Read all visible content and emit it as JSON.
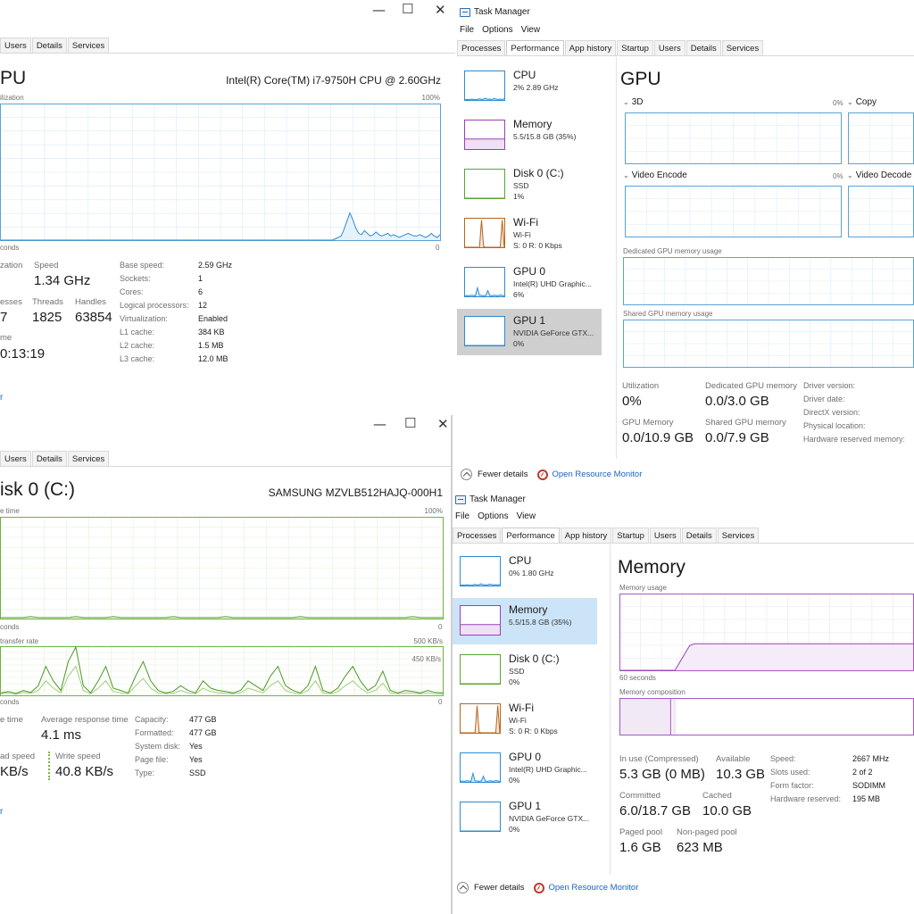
{
  "common": {
    "tabs_short": [
      "Users",
      "Details",
      "Services"
    ],
    "tabs_full": [
      "Processes",
      "Performance",
      "App history",
      "Startup",
      "Users",
      "Details",
      "Services"
    ],
    "menu": [
      "File",
      "Options",
      "View"
    ],
    "app_title": "Task Manager",
    "fewer_details": "Fewer details",
    "open_resource_monitor": "Open Resource Monitor",
    "win_min": "—",
    "win_max": "☐",
    "win_close": "✕"
  },
  "cpu_panel": {
    "title": "PU",
    "cpu_name": "Intel(R) Core(TM) i7-9750H CPU @ 2.60GHz",
    "graph_label": "ilization",
    "graph_max": "100%",
    "time_left": "conds",
    "time_right": "0",
    "utilization_label": "zation",
    "utilization_value": "",
    "speed_label": "Speed",
    "speed_value": "1.34 GHz",
    "processes_label": "esses",
    "processes_value": "7",
    "threads_label": "Threads",
    "threads_value": "1825",
    "handles_label": "Handles",
    "handles_value": "63854",
    "uptime_label": "me",
    "uptime_value": "0:13:19",
    "link_frag": "r",
    "specs": [
      {
        "k": "Base speed:",
        "v": "2.59 GHz"
      },
      {
        "k": "Sockets:",
        "v": "1"
      },
      {
        "k": "Cores:",
        "v": "6"
      },
      {
        "k": "Logical processors:",
        "v": "12"
      },
      {
        "k": "Virtualization:",
        "v": "Enabled"
      },
      {
        "k": "L1 cache:",
        "v": "384 KB"
      },
      {
        "k": "L2 cache:",
        "v": "1.5 MB"
      },
      {
        "k": "L3 cache:",
        "v": "12.0 MB"
      }
    ],
    "series": [
      0,
      0,
      0,
      0,
      0,
      0,
      0,
      0,
      0,
      0,
      0,
      0,
      0,
      0,
      0,
      0,
      0,
      0,
      0,
      0,
      0,
      0,
      0,
      0,
      0,
      0,
      0,
      0,
      0,
      0,
      0,
      0,
      0,
      0,
      0,
      0,
      0,
      0,
      0,
      0,
      0,
      0,
      0,
      0,
      0,
      0,
      0,
      0,
      0,
      0,
      0,
      0,
      0,
      0,
      0,
      0,
      0,
      0,
      0,
      0,
      0,
      0,
      0,
      0,
      0,
      0,
      0,
      0,
      0,
      0,
      0,
      0,
      0,
      0,
      0,
      0,
      0,
      0,
      0,
      0,
      0,
      0,
      0,
      0,
      0,
      0,
      0,
      0,
      0,
      0,
      0,
      0,
      0,
      0,
      0,
      0,
      0,
      0,
      0,
      0,
      0,
      0,
      0,
      0,
      0,
      0,
      0,
      0,
      0,
      0,
      0,
      0,
      0,
      0,
      0,
      1,
      2,
      3,
      8,
      14,
      20,
      15,
      9,
      5,
      4,
      7,
      5,
      3,
      4,
      6,
      4,
      3,
      4,
      5,
      3,
      4,
      3,
      2,
      3,
      4,
      5,
      4,
      3,
      3,
      4,
      3,
      2,
      3,
      5,
      3,
      2,
      4
    ]
  },
  "gpu_panel": {
    "sidebar": [
      {
        "title": "CPU",
        "s1": "2% 2.89 GHz",
        "s2": "",
        "color": "#2c8cd1",
        "fill": "#cfe7f7",
        "kind": "cpu"
      },
      {
        "title": "Memory",
        "s1": "5.5/15.8 GB (35%)",
        "s2": "",
        "color": "#9b3fb5",
        "fill": "#efe0f5",
        "kind": "mem"
      },
      {
        "title": "Disk 0 (C:)",
        "s1": "SSD",
        "s2": "1%",
        "color": "#5aa431",
        "fill": "#e8f4df",
        "kind": "flat"
      },
      {
        "title": "Wi-Fi",
        "s1": "Wi-Fi",
        "s2": "S: 0 R: 0 Kbps",
        "color": "#b5651d",
        "fill": "#f6e6d6",
        "kind": "wifi"
      },
      {
        "title": "GPU 0",
        "s1": "Intel(R) UHD Graphic...",
        "s2": "6%",
        "color": "#2c8cd1",
        "fill": "#cfe7f7",
        "kind": "gpu0"
      },
      {
        "title": "GPU 1",
        "s1": "NVIDIA GeForce GTX...",
        "s2": "0%",
        "color": "#2c8cd1",
        "fill": "#cfe7f7",
        "kind": "flat"
      }
    ],
    "title": "GPU",
    "engines": [
      {
        "name": "3D",
        "pct": "0%"
      },
      {
        "name": "Copy",
        "pct": ""
      },
      {
        "name": "Video Encode",
        "pct": "0%"
      },
      {
        "name": "Video Decode",
        "pct": ""
      }
    ],
    "dedicated_label": "Dedicated GPU memory usage",
    "shared_label": "Shared GPU memory usage",
    "utilization_label": "Utilization",
    "utilization_value": "0%",
    "dedicated_mem_label": "Dedicated GPU memory",
    "dedicated_mem_value": "0.0/3.0 GB",
    "gpu_memory_label": "GPU Memory",
    "gpu_memory_value": "0.0/10.9 GB",
    "shared_mem_label": "Shared GPU memory",
    "shared_mem_value": "0.0/7.9 GB",
    "specs": [
      "Driver version:",
      "Driver date:",
      "DirectX version:",
      "Physical location:",
      "Hardware reserved memory:"
    ]
  },
  "disk_panel": {
    "title": "isk 0 (C:)",
    "disk_name": "SAMSUNG MZVLB512HAJQ-000H1",
    "graph1_label": "e time",
    "graph1_max": "100%",
    "time_left": "conds",
    "time_right": "0",
    "graph2_label": "transfer rate",
    "graph2_max": "500 KB/s",
    "graph2_mid": "450 KB/s",
    "active_label": "e time",
    "active_value": "",
    "resp_label": "Average response time",
    "resp_value": "4.1 ms",
    "read_label": "ad speed",
    "read_value": "KB/s",
    "write_label": "Write speed",
    "write_value": "40.8 KB/s",
    "link_frag": "r",
    "specs": [
      {
        "k": "Capacity:",
        "v": "477 GB"
      },
      {
        "k": "Formatted:",
        "v": "477 GB"
      },
      {
        "k": "System disk:",
        "v": "Yes"
      },
      {
        "k": "Page file:",
        "v": "Yes"
      },
      {
        "k": "Type:",
        "v": "SSD"
      }
    ],
    "series_active": [
      1,
      1,
      1,
      1,
      2,
      1,
      1,
      1,
      1,
      1,
      2,
      1,
      1,
      1,
      1,
      2,
      1,
      1,
      1,
      1,
      1,
      1,
      1,
      2,
      1,
      1,
      1,
      1,
      1,
      1,
      2,
      1,
      1,
      1,
      1,
      1,
      1,
      1,
      1,
      1,
      2,
      1,
      1,
      1,
      1,
      1,
      1,
      1,
      1,
      1,
      1,
      1,
      1,
      1,
      1,
      2,
      1,
      1,
      1,
      1
    ],
    "series_transfer_a": [
      5,
      8,
      4,
      10,
      6,
      20,
      60,
      30,
      10,
      70,
      100,
      20,
      5,
      30,
      60,
      15,
      10,
      5,
      40,
      70,
      30,
      10,
      5,
      8,
      20,
      10,
      5,
      30,
      15,
      10,
      8,
      5,
      10,
      30,
      20,
      10,
      40,
      60,
      20,
      10,
      5,
      20,
      60,
      10,
      5,
      15,
      40,
      60,
      30,
      10,
      20,
      50,
      10,
      5,
      10,
      8,
      5,
      10,
      6,
      5
    ],
    "series_transfer_b": [
      3,
      5,
      2,
      6,
      4,
      10,
      30,
      15,
      5,
      40,
      60,
      10,
      3,
      15,
      30,
      8,
      5,
      3,
      20,
      35,
      15,
      5,
      3,
      4,
      10,
      5,
      3,
      15,
      8,
      5,
      4,
      3,
      5,
      15,
      10,
      5,
      20,
      30,
      10,
      5,
      3,
      10,
      30,
      5,
      3,
      8,
      20,
      30,
      15,
      5,
      10,
      25,
      5,
      3,
      5,
      4,
      3,
      5,
      3,
      3
    ]
  },
  "memory_panel": {
    "sidebar": [
      {
        "title": "CPU",
        "s1": "0% 1.80 GHz",
        "s2": "",
        "color": "#2c8cd1",
        "fill": "#cfe7f7",
        "kind": "cpu"
      },
      {
        "title": "Memory",
        "s1": "5.5/15.8 GB (35%)",
        "s2": "",
        "color": "#9b3fb5",
        "fill": "#efe0f5",
        "kind": "mem"
      },
      {
        "title": "Disk 0 (C:)",
        "s1": "SSD",
        "s2": "0%",
        "color": "#5aa431",
        "fill": "#e8f4df",
        "kind": "flat"
      },
      {
        "title": "Wi-Fi",
        "s1": "Wi-Fi",
        "s2": "S: 0 R: 0 Kbps",
        "color": "#b5651d",
        "fill": "#f6e6d6",
        "kind": "wifi"
      },
      {
        "title": "GPU 0",
        "s1": "Intel(R) UHD Graphic...",
        "s2": "0%",
        "color": "#2c8cd1",
        "fill": "#cfe7f7",
        "kind": "gpu0"
      },
      {
        "title": "GPU 1",
        "s1": "NVIDIA GeForce GTX...",
        "s2": "0%",
        "color": "#2c8cd1",
        "fill": "#cfe7f7",
        "kind": "flat"
      }
    ],
    "title": "Memory",
    "usage_label": "Memory usage",
    "time_left": "60 seconds",
    "composition_label": "Memory composition",
    "in_use_label": "In use (Compressed)",
    "in_use_value": "5.3 GB (0 MB)",
    "available_label": "Available",
    "available_value": "10.3 GB",
    "committed_label": "Committed",
    "committed_value": "6.0/18.7 GB",
    "cached_label": "Cached",
    "cached_value": "10.0 GB",
    "paged_label": "Paged pool",
    "paged_value": "1.6 GB",
    "nonpaged_label": "Non-paged pool",
    "nonpaged_value": "623 MB",
    "specs": [
      {
        "k": "Speed:",
        "v": "2667 MHz"
      },
      {
        "k": "Slots used:",
        "v": "2 of 2"
      },
      {
        "k": "Form factor:",
        "v": "SODIMM"
      },
      {
        "k": "Hardware reserved:",
        "v": "195 MB"
      }
    ],
    "in_use_fraction": 0.35
  }
}
